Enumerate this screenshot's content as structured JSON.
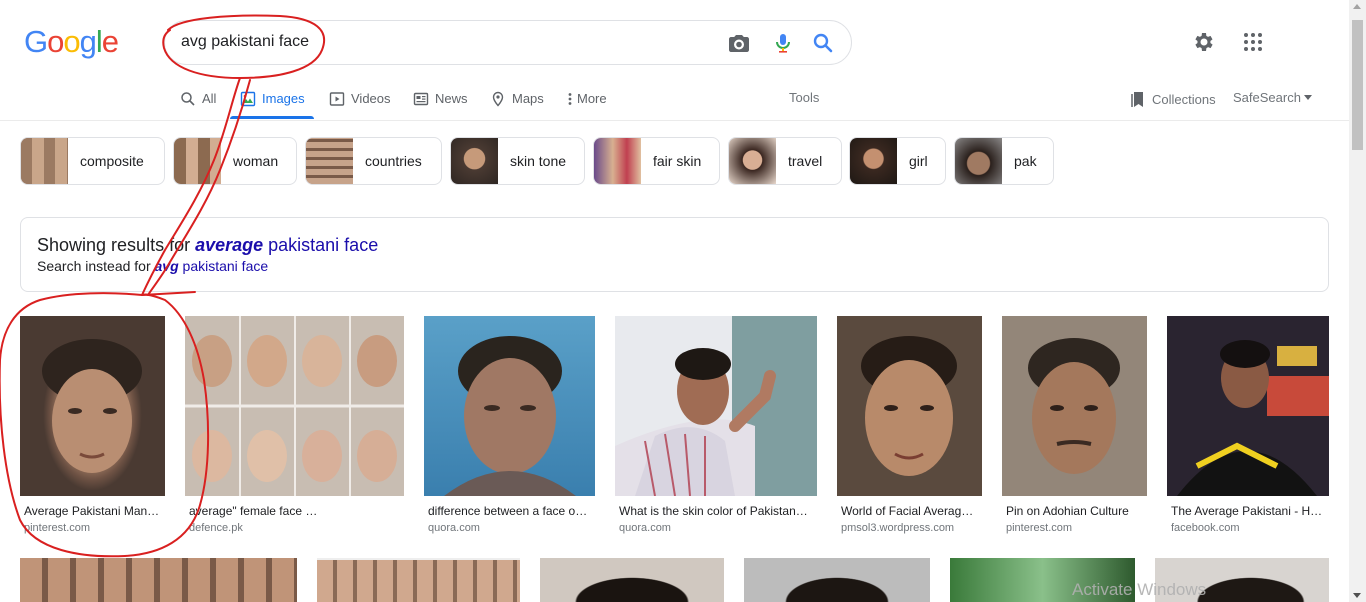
{
  "logo": {
    "text": "Google",
    "letters": [
      "G",
      "o",
      "o",
      "g",
      "l",
      "e"
    ],
    "colors": [
      "#4285f4",
      "#ea4335",
      "#fbbc05",
      "#4285f4",
      "#34a853",
      "#ea4335"
    ]
  },
  "search": {
    "value": "avg pakistani face"
  },
  "icons": {
    "camera": "camera-icon",
    "mic": "mic-icon",
    "search": "search-icon",
    "settings": "gear-icon",
    "apps": "apps-grid-icon"
  },
  "tabs": [
    {
      "label": "All",
      "icon": "search-icon"
    },
    {
      "label": "Images",
      "icon": "image-icon"
    },
    {
      "label": "Videos",
      "icon": "play-icon"
    },
    {
      "label": "News",
      "icon": "news-icon"
    },
    {
      "label": "Maps",
      "icon": "map-pin-icon"
    },
    {
      "label": "More",
      "icon": "more-vert-icon"
    }
  ],
  "tools": {
    "label": "Tools"
  },
  "collections": {
    "label": "Collections"
  },
  "safesearch": {
    "label": "SafeSearch"
  },
  "chips": [
    {
      "label": "composite"
    },
    {
      "label": "woman"
    },
    {
      "label": "countries"
    },
    {
      "label": "skin tone"
    },
    {
      "label": "fair skin"
    },
    {
      "label": "travel"
    },
    {
      "label": "girl"
    },
    {
      "label": "pak"
    }
  ],
  "correction": {
    "prefix": "Showing results for ",
    "bold_term": "average",
    "rest": " pakistani face",
    "instead_prefix": "Search instead for ",
    "instead_bold": "avg",
    "instead_rest": " pakistani face"
  },
  "results": [
    {
      "title": "Average Pakistani Man…",
      "domain": "pinterest.com"
    },
    {
      "title": "average\" female face …",
      "domain": "defence.pk"
    },
    {
      "title": "difference between a face o…",
      "domain": "quora.com"
    },
    {
      "title": "What is the skin color of Pakistan…",
      "domain": "quora.com"
    },
    {
      "title": "World of Facial Averag…",
      "domain": "pmsol3.wordpress.com"
    },
    {
      "title": "Pin on Adohian Culture",
      "domain": "pinterest.com"
    },
    {
      "title": "The Average Pakistani - H…",
      "domain": "facebook.com"
    }
  ],
  "watermark": {
    "text": "Activate Windows"
  },
  "colors": {
    "accent": "#1a73e8",
    "link": "#1a0dab",
    "annotation": "#d92020"
  }
}
